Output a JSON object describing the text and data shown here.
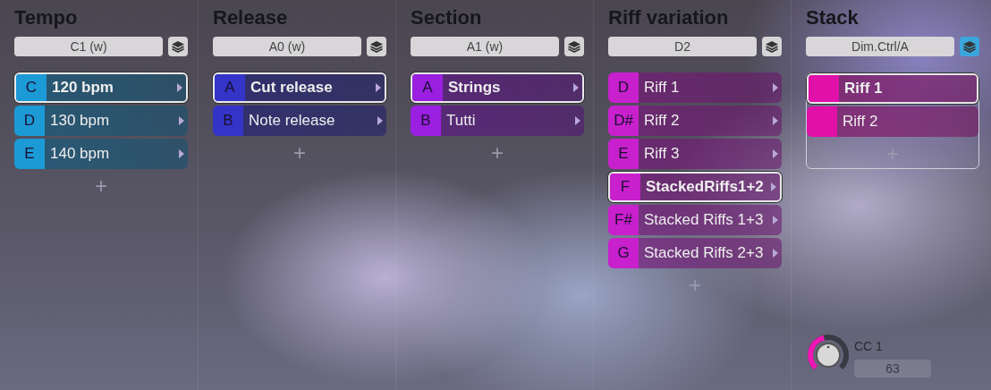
{
  "columns": [
    {
      "kind": "list",
      "title": "Tempo",
      "selector": "C1 (w)",
      "layers_active": false,
      "color": "#1c9ad6",
      "items": [
        {
          "key": "C",
          "label": "120 bpm",
          "selected": true
        },
        {
          "key": "D",
          "label": "130 bpm",
          "selected": false
        },
        {
          "key": "E",
          "label": "140 bpm",
          "selected": false
        }
      ],
      "add": "+"
    },
    {
      "kind": "list",
      "title": "Release",
      "selector": "A0 (w)",
      "layers_active": false,
      "color": "#3434c8",
      "items": [
        {
          "key": "A",
          "label": "Cut release",
          "selected": true
        },
        {
          "key": "B",
          "label": "Note release",
          "selected": false
        }
      ],
      "add": "+"
    },
    {
      "kind": "list",
      "title": "Section",
      "selector": "A1 (w)",
      "layers_active": false,
      "color": "#9a1fe0",
      "items": [
        {
          "key": "A",
          "label": "Strings",
          "selected": true
        },
        {
          "key": "B",
          "label": "Tutti",
          "selected": false
        }
      ],
      "add": "+"
    },
    {
      "kind": "list",
      "title": "Riff variation",
      "selector": "D2",
      "layers_active": false,
      "color": "#c820cc",
      "items": [
        {
          "key": "D",
          "label": "Riff 1",
          "selected": false
        },
        {
          "key": "D#",
          "label": "Riff 2",
          "selected": false
        },
        {
          "key": "E",
          "label": "Riff 3",
          "selected": false
        },
        {
          "key": "F",
          "label": "StackedRiffs1+2",
          "selected": true
        },
        {
          "key": "F#",
          "label": "Stacked Riffs 1+3",
          "selected": false
        },
        {
          "key": "G",
          "label": "Stacked Riffs 2+3",
          "selected": false
        }
      ],
      "add": "+"
    },
    {
      "kind": "stack",
      "title": "Stack",
      "selector": "Dim.Ctrl/A",
      "layers_active": true,
      "color": "#e010a8",
      "items": [
        {
          "label": "Riff 1",
          "selected": true
        },
        {
          "label": "Riff 2",
          "selected": false
        }
      ],
      "add": "+",
      "knob": {
        "label": "CC 1",
        "value": "63"
      }
    }
  ]
}
